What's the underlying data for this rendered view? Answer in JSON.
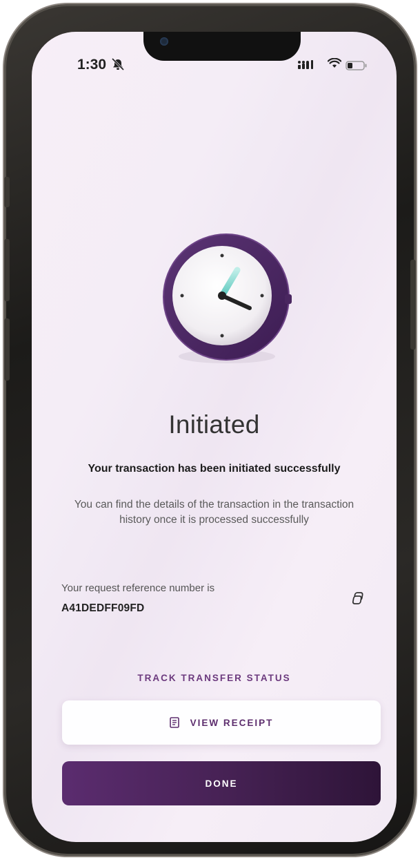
{
  "status_bar": {
    "time": "1:30",
    "icons": [
      "bell-slash-icon",
      "signal-icon",
      "wifi-icon",
      "battery-icon"
    ]
  },
  "result": {
    "illustration": "clock-icon",
    "title": "Initiated",
    "subtitle": "Your transaction has been initiated successfully",
    "details": "You can find the details of the transaction in the transaction history once it is processed successfully"
  },
  "reference": {
    "label": "Your request reference number is",
    "value": "A41DEDFF09FD",
    "copy_icon": "copy-icon"
  },
  "actions": {
    "track_label": "TRACK TRANSFER STATUS",
    "receipt_label": "VIEW RECEIPT",
    "receipt_icon": "receipt-icon",
    "done_label": "DONE"
  },
  "colors": {
    "accent": "#5b2c6f",
    "accent_dark": "#2e1438",
    "clock_hand": "#5cc8be",
    "background": "#f4edf6"
  }
}
